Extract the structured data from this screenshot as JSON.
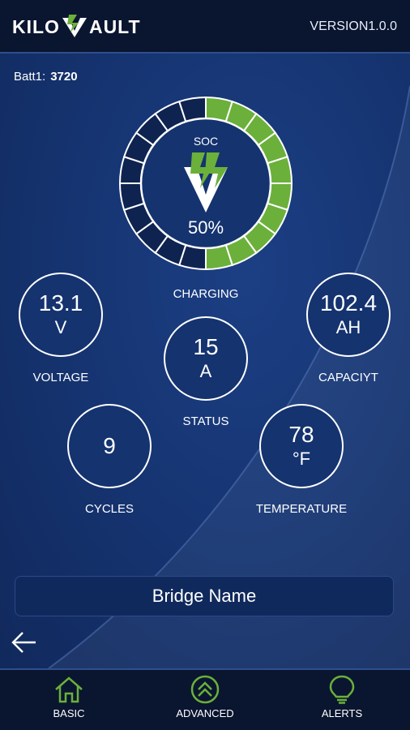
{
  "header": {
    "brand": "KILOVAULT",
    "brand_left": "KILO",
    "brand_right": "AULT",
    "version": "VERSION1.0.0",
    "logo_icon": "kilovault-v-logo"
  },
  "battery": {
    "label": "Batt1:",
    "id": "3720"
  },
  "soc": {
    "label": "SOC",
    "value": "50%",
    "fraction": 0.5,
    "fill_color": "#6bb03a",
    "empty_color": "#0f2350"
  },
  "metrics": {
    "voltage": {
      "value": "13.1",
      "unit": "V",
      "caption": "VOLTAGE"
    },
    "capacity": {
      "value": "102.4",
      "unit": "AH",
      "caption": "CAPACIYT"
    },
    "current": {
      "value": "15",
      "unit": "A",
      "status_text": "CHARGING",
      "caption": "STATUS"
    },
    "cycles": {
      "value": "9",
      "caption": "CYCLES"
    },
    "temperature": {
      "value": "78",
      "unit": "°F",
      "caption": "TEMPERATURE"
    }
  },
  "bridge": {
    "label": "Bridge Name"
  },
  "nav": {
    "items": [
      {
        "label": "BASIC",
        "icon": "home-icon"
      },
      {
        "label": "ADVANCED",
        "icon": "double-chevron-up-icon"
      },
      {
        "label": "ALERTS",
        "icon": "lightbulb-icon"
      }
    ]
  },
  "colors": {
    "accent_green": "#6bb03a",
    "background_blue": "#163573",
    "header_dark": "#0a1530"
  }
}
